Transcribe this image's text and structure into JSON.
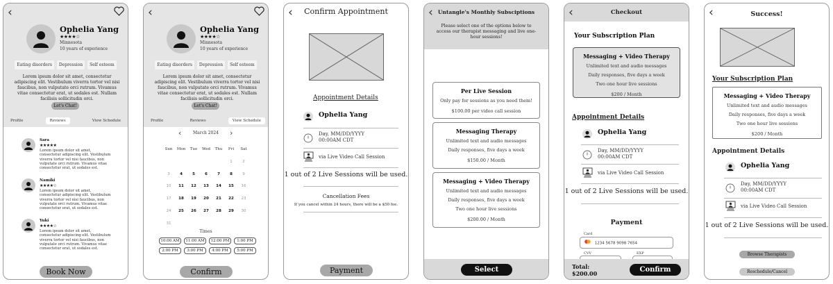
{
  "common": {
    "back_glyph": "‹",
    "therapist_name": "Ophelia Yang",
    "stars": "★★★★☆",
    "location": "Minnesota",
    "experience": "10 years of experience",
    "tags": [
      "Eating disorders",
      "Depression",
      "Self esteem"
    ],
    "bio": "Lorem ipsum dolor sit amet, consectetur adipiscing elit. Vestibulum viverra tortor vel nisi faucibus, non vulputate orci rutrum. Vivamus vitae consectetur erat, ut sodales est. Nullam facilisis sollicitudin orci.",
    "chat_label": "Let's Chat!",
    "tabs": [
      "Profile",
      "Reviews",
      "View Schedule"
    ]
  },
  "screen1": {
    "reviews": [
      {
        "name": "Sara",
        "stars": "★★★★★",
        "text": "Lorem ipsum dolor sit amet, consectetur adipiscing elit. Vestibulum viverra tortor vel nisi faucibus, non vulputate orci rutrum. Vivamus vitae consectetur erat, ut sodales est."
      },
      {
        "name": "Namiki",
        "stars": "★★★★☆",
        "text": "Lorem ipsum dolor sit amet, consectetur adipiscing elit. Vestibulum viverra tortor vel nisi faucibus, non vulputate orci rutrum. Vivamus vitae consectetur erat, ut sodales est."
      },
      {
        "name": "Yuki",
        "stars": "★★★★☆",
        "text": "Lorem ipsum dolor sit amet, consectetur adipiscing elit. Vestibulum viverra tortor vel nisi faucibus, non vulputate orci rutrum. Vivamus vitae consectetur erat, ut sodales est."
      }
    ],
    "book_label": "Book Now"
  },
  "screen2": {
    "month": "March 2024",
    "weekdays": [
      "Sun",
      "Mon",
      "Tue",
      "Wed",
      "Thu",
      "Fri",
      "Sat"
    ],
    "days": [
      {
        "d": "",
        "on": false
      },
      {
        "d": "",
        "on": false
      },
      {
        "d": "",
        "on": false
      },
      {
        "d": "",
        "on": false
      },
      {
        "d": "",
        "on": false
      },
      {
        "d": "1",
        "on": false
      },
      {
        "d": "2",
        "on": false
      },
      {
        "d": "3",
        "on": false
      },
      {
        "d": "4",
        "on": true
      },
      {
        "d": "5",
        "on": true
      },
      {
        "d": "6",
        "on": true
      },
      {
        "d": "7",
        "on": true
      },
      {
        "d": "8",
        "on": true
      },
      {
        "d": "9",
        "on": false
      },
      {
        "d": "10",
        "on": false
      },
      {
        "d": "11",
        "on": true
      },
      {
        "d": "12",
        "on": true
      },
      {
        "d": "13",
        "on": true
      },
      {
        "d": "14",
        "on": true
      },
      {
        "d": "15",
        "on": true
      },
      {
        "d": "16",
        "on": false
      },
      {
        "d": "17",
        "on": false
      },
      {
        "d": "18",
        "on": true
      },
      {
        "d": "19",
        "on": true
      },
      {
        "d": "20",
        "on": true
      },
      {
        "d": "21",
        "on": true
      },
      {
        "d": "22",
        "on": true
      },
      {
        "d": "23",
        "on": false
      },
      {
        "d": "24",
        "on": false
      },
      {
        "d": "25",
        "on": true
      },
      {
        "d": "26",
        "on": true
      },
      {
        "d": "27",
        "on": true
      },
      {
        "d": "28",
        "on": true
      },
      {
        "d": "29",
        "on": true
      },
      {
        "d": "30",
        "on": false
      },
      {
        "d": "31",
        "on": false
      }
    ],
    "times_label": "Times",
    "times": [
      "10:00 AM",
      "11:00 AM",
      "12:00 PM",
      "1:00 PM",
      "2:00 PM",
      "3:00 PM",
      "4:00 PM",
      "5:00 PM"
    ],
    "confirm_label": "Confirm"
  },
  "screen3": {
    "title": "Confirm Appointment",
    "details_title": "Appointment Details",
    "datetime_line1": "Day, MM/DD/YYYY",
    "datetime_line2": "00:00AM CDT",
    "session_type": "via Live Video Call Session",
    "usage": "1 out of 2 Live Sessions will be used.",
    "fees_title": "Cancellation Fees",
    "fees_text": "If you cancel within 24 hours, there will be a $50 fee.",
    "payment_label": "Payment"
  },
  "screen4": {
    "title": "Untangle's Monthly Subsciptions",
    "intro": "Please select one of the options below to access our therapist messaging and live one-hour sessions!",
    "plans": [
      {
        "name": "Per Live Session",
        "lines": [
          "Only pay for sessions as you need them!"
        ],
        "price": "$100.00 per video call session"
      },
      {
        "name": "Messaging Therapy",
        "lines": [
          "Unlimited text and audio messages",
          "Daily responses, five days a week"
        ],
        "price": "$150.00 / Month"
      },
      {
        "name": "Messaging + Video Therapy",
        "lines": [
          "Unlimited text and audio messages",
          "Daily responses, five days a week",
          "Two one hour live sessions"
        ],
        "price": "$200.00 / Month"
      }
    ],
    "select_label": "Select"
  },
  "screen5": {
    "title": "Checkout",
    "plan_heading": "Your Subscription Plan",
    "plan": {
      "name": "Messaging + Video Therapy",
      "lines": [
        "Unlimited text and audio messages",
        "Daily responses, five days a week",
        "Two one hour live sessions"
      ],
      "price": "$200 / Month"
    },
    "details_title": "Appointment Details",
    "payment_title": "Payment",
    "card_label": "Card",
    "card_number": "1234   5678   9098   7654",
    "cvv_label": "CVV",
    "exp_label": "EXP",
    "total_label": "Total:",
    "total_value": "$200.00",
    "confirm_label": "Confirm"
  },
  "screen6": {
    "title": "Success!",
    "plan_heading": "Your Subscription Plan",
    "plan": {
      "name": "Messaging + Video Therapy",
      "lines": [
        "Unlimited text and audio messages",
        "Daily responses, five days a week",
        "Two one hour live sessions"
      ],
      "price": "$200 / Month"
    },
    "details_title": "Appointment Details",
    "browse_label": "Browse Therapists",
    "reschedule_label": "Reschedule/Cancel"
  }
}
